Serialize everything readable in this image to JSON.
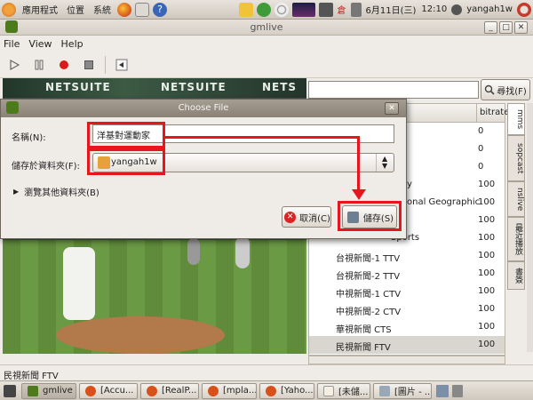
{
  "topbar": {
    "menus": [
      "應用程式",
      "位置",
      "系統"
    ],
    "date": "6月11日(三)",
    "time": "12:10",
    "user": "yangah1w",
    "lang": "倉"
  },
  "window": {
    "title": "gmlive",
    "menu": [
      "File",
      "View",
      "Help"
    ]
  },
  "video": {
    "banner_texts": [
      "NETSUITE",
      "NETSUITE",
      "NETS"
    ]
  },
  "right": {
    "search_placeholder": "",
    "find_button": "尋找(F)",
    "col_bitrate": "bitrate",
    "rows": [
      {
        "name": "",
        "bitrate": "0"
      },
      {
        "name": "",
        "bitrate": "0"
      },
      {
        "name": "",
        "bitrate": "0"
      },
      {
        "name": "y",
        "bitrate": "100"
      },
      {
        "name": "onal Geographic",
        "bitrate": "100"
      },
      {
        "name": "",
        "bitrate": "100"
      },
      {
        "name": "Sports",
        "bitrate": "100"
      },
      {
        "name": "台視新聞-1 TTV",
        "bitrate": "100"
      },
      {
        "name": "台視新聞-2 TTV",
        "bitrate": "100"
      },
      {
        "name": "中視新聞-1 CTV",
        "bitrate": "100"
      },
      {
        "name": "中視新聞-2 CTV",
        "bitrate": "100"
      },
      {
        "name": "華視新聞 CTS",
        "bitrate": "100"
      },
      {
        "name": "民視新聞 FTV",
        "bitrate": "100"
      }
    ],
    "tabs": [
      "mms",
      "sopcast",
      "nslive",
      "最近播放",
      "書簽"
    ]
  },
  "status": {
    "text": "民視新聞 FTV"
  },
  "taskbar": {
    "tasks": [
      "gmlive",
      "[Accu...",
      "[RealP...",
      "[mpla...",
      "[Yaho...",
      "[未儲...",
      "[圖片 - ..."
    ]
  },
  "dialog": {
    "title": "Choose File",
    "name_label": "名稱(N):",
    "name_value": "洋基對運動家",
    "folder_label": "儲存於資料夾(F):",
    "folder_value": "yangah1w",
    "browse_label": "瀏覽其他資料夾(B)",
    "cancel_button": "取消(C)",
    "save_button": "儲存(S)"
  },
  "colors": {
    "highlight": "#e8141e"
  }
}
